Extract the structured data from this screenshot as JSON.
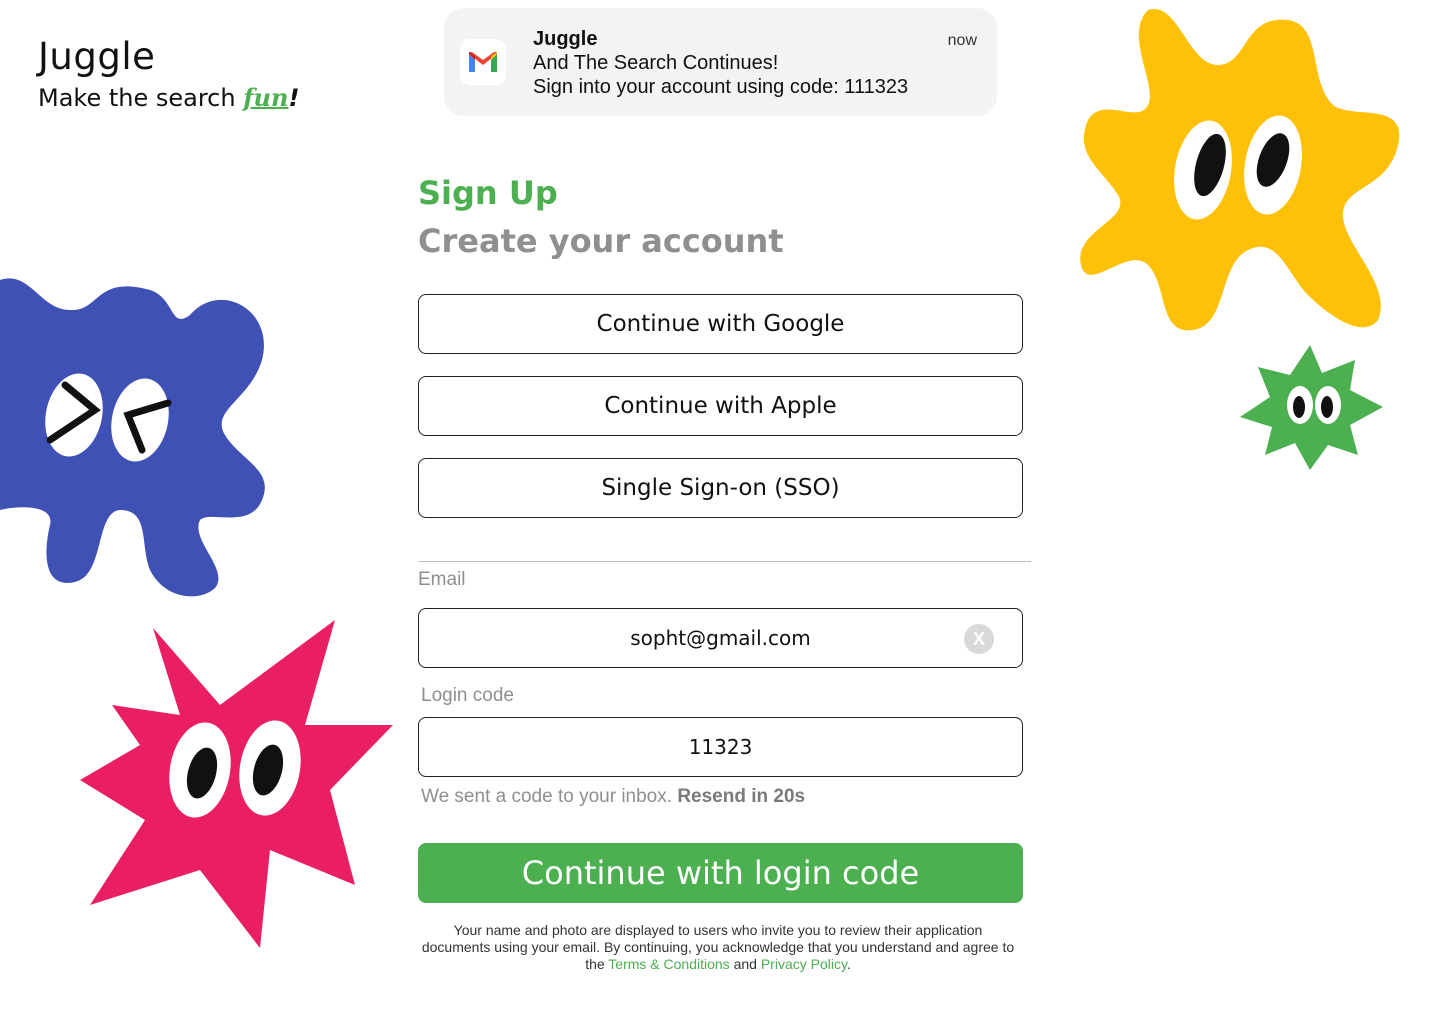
{
  "brand": {
    "title": "Juggle",
    "tagline_prefix": "Make the search ",
    "tagline_accent": "fun",
    "tagline_suffix": "!"
  },
  "notification": {
    "app": "Juggle",
    "title": "And The Search Continues!",
    "body": "Sign into your account using code: 111323",
    "time": "now",
    "icon": "gmail-icon"
  },
  "form": {
    "heading": "Sign Up",
    "subheading": "Create your account",
    "buttons": {
      "google": "Continue with Google",
      "apple": "Continue with Apple",
      "sso": "Single Sign-on (SSO)"
    },
    "email": {
      "label": "Email",
      "value": "sopht@gmail.com",
      "clear_label": "X"
    },
    "login_code": {
      "label": "Login code",
      "value": "11323"
    },
    "hint": "We sent a code to your inbox.",
    "resend": "Resend in 20s",
    "submit": "Continue with login code",
    "legal": {
      "text_before": "Your name and photo are displayed to users who invite you to review their application documents using your email. By continuing, you acknowledge that you understand and agree to the ",
      "terms": "Terms & Conditions",
      "and": " and ",
      "privacy": "Privacy Policy",
      "end": "."
    }
  },
  "colors": {
    "accent": "#4caf50",
    "blue_blob": "#3f51b5",
    "pink_blob": "#e91e63",
    "yellow_blob": "#ffc107",
    "green_blob": "#4caf50"
  },
  "decorations": [
    "blue-blob-mascot",
    "pink-star-mascot",
    "yellow-blob-mascot",
    "green-star-mascot"
  ]
}
